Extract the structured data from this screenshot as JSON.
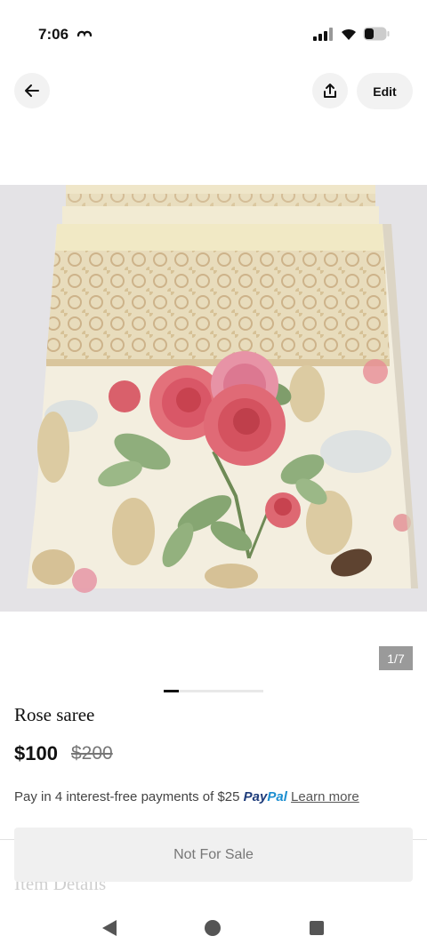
{
  "status_bar": {
    "time": "7:06",
    "icons": [
      "link-icon",
      "signal-icon",
      "wifi-icon",
      "battery-icon"
    ]
  },
  "header": {
    "back_icon": "arrow-left-icon",
    "share_icon": "share-icon",
    "edit_label": "Edit"
  },
  "photo": {
    "description_icon": "saree-photo",
    "counter": "1/7",
    "carousel_progress": 0.15
  },
  "item": {
    "title": "Rose saree",
    "price": "$100",
    "original_price": "$200"
  },
  "paypal": {
    "text": "Pay in 4 interest-free payments of $25",
    "logo_pay": "Pay",
    "logo_pal": "Pal",
    "learn_more": "Learn more"
  },
  "section": {
    "item_details": "Item Details"
  },
  "action": {
    "not_for_sale": "Not For Sale"
  },
  "android_nav": {
    "icons": [
      "back-triangle-icon",
      "home-circle-icon",
      "recents-square-icon"
    ]
  },
  "colors": {
    "paypal_dark": "#1d3b7a",
    "paypal_light": "#1b8ed0",
    "button_bg": "#f2f2f2"
  }
}
